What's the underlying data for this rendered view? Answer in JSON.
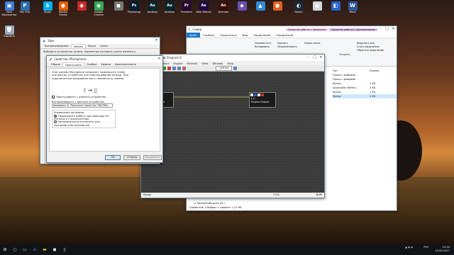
{
  "desktop": {
    "icons": [
      {
        "label": "Мой Компьютер",
        "glyph": "▣",
        "color": "#3b7dd8"
      },
      {
        "label": "Pak CHA",
        "glyph": "P",
        "color": "#2a6fb0"
      },
      {
        "label": "Skype",
        "glyph": "S",
        "color": "#00aff0"
      },
      {
        "label": "Mozilla Firefox",
        "glyph": "●",
        "color": "#e66000"
      },
      {
        "label": "",
        "glyph": "◉",
        "color": "#c62828"
      },
      {
        "label": "Google Chrome",
        "glyph": "◉",
        "color": "#34a853"
      },
      {
        "label": "",
        "glyph": "◼",
        "color": "#777777"
      },
      {
        "label": "Photoshop",
        "glyph": "Ps",
        "color": "#001d34"
      },
      {
        "label": "Audition",
        "glyph": "Au",
        "color": "#00262c"
      },
      {
        "label": "Audition",
        "glyph": "Au",
        "color": "#00262c"
      },
      {
        "label": "Premiere",
        "glyph": "Pr",
        "color": "#2a0634"
      },
      {
        "label": "After Effects",
        "glyph": "Ae",
        "color": "#1f0740"
      },
      {
        "label": "Animate",
        "glyph": "An",
        "color": "#3b0a04"
      },
      {
        "label": "",
        "glyph": "◆",
        "color": "#6a4fb0"
      },
      {
        "label": "",
        "glyph": "▲",
        "color": "#2e8bd8"
      },
      {
        "label": "",
        "glyph": "●",
        "color": "#e06020"
      },
      {
        "label": "Steam",
        "glyph": "◐",
        "color": "#1b2838"
      },
      {
        "label": "",
        "glyph": "▣",
        "color": "#cfd8dc"
      },
      {
        "label": "",
        "glyph": "◧",
        "color": "#2a62c9"
      },
      {
        "label": "Word",
        "glyph": "W",
        "color": "#2b579a"
      }
    ],
    "recycle_bin": "Корзина"
  },
  "explorer": {
    "title": "С: Серви",
    "context_tab_1": "Средства работы с ярлыками",
    "context_tab_2": "Средства работы с приложениями",
    "tabs": [
      "Файл",
      "Главная",
      "Поделиться",
      "Вид",
      "Управление",
      "Управление"
    ],
    "ribbon_actions": [
      "Переместить",
      "Копировать",
      "Удалить",
      "Переименовать",
      "Новая папка",
      "Открыть",
      "Выделить всё",
      "Снять выделение",
      "Обратить выделение"
    ],
    "columns": [
      "Тип",
      "Размер"
    ],
    "rows": [
      {
        "type": "Папка с файлами",
        "size": ""
      },
      {
        "type": "Папка с файлами",
        "size": ""
      },
      {
        "type": "Ярлык",
        "size": "1 КБ"
      },
      {
        "type": "Application Refere...",
        "size": "2 КБ"
      },
      {
        "type": "Ярлык",
        "size": "1 КБ"
      },
      {
        "type": "Ярлык",
        "size": "1 КБ"
      }
    ],
    "drive": "Локальный диск (D:)",
    "status": "Элементов: 3   Выбран 1 элемент: 1,47 КБ"
  },
  "engine": {
    "title": "1 - Engine Input Program 0",
    "menu": [
      "File",
      "Performance",
      "Engine",
      "Devices",
      "View",
      "Window",
      "Help"
    ],
    "buffer": "128 fps",
    "node_input": "Engine Input",
    "node_output": "Engine Output",
    "status_left": "Ready",
    "status_mid": "7,2%",
    "status_right": "NUM"
  },
  "sound": {
    "title": "Звук",
    "tabs": [
      "Воспроизведение",
      "Запись",
      "Звуки",
      "Связь"
    ],
    "subtitle": "Выберите устройство записи, параметры которого нужно изменить:"
  },
  "mic": {
    "title": "Свойства: Microphone",
    "tabs": [
      "Общие",
      "Прослушать",
      "Особые",
      "Уровни",
      "Дополнительно"
    ],
    "description": "Этот разъем Microphone позволяет подключить плеер или другое устройство для прослушивания музыки. При подключенном микрофоне могут возникнуть помехи.",
    "listen_checkbox": "Прослушивать с данного устройства",
    "playback_label": "Воспроизводить с данного устройства:",
    "playback_device": "Динамики (2- Plantronics GameCom 780/788)",
    "power_label": "Управление питанием",
    "option_1": "Продолжить работу при переходе на питание от аккумулятора",
    "option_2": "Автоматически отключить для экономии электроэнергии",
    "ok": "OK",
    "cancel": "Отмена",
    "apply": "Применить"
  },
  "taskbar": {
    "lang": "РУС",
    "time": "23:35",
    "date": "20.04.2017"
  }
}
